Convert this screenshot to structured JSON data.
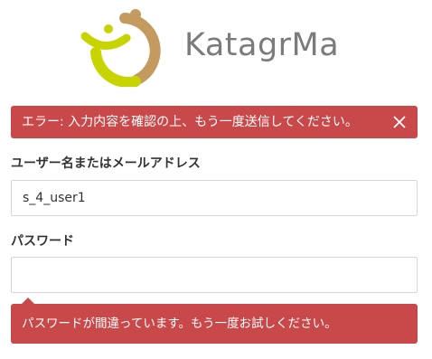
{
  "brand": {
    "name": "KatagrMa",
    "colors": {
      "lime": "#c8d400",
      "gold": "#c49a5e",
      "text_gray": "#7b7b7b"
    }
  },
  "alert": {
    "message": "エラー: 入力内容を確認の上、もう一度送信してください。",
    "close_icon": "close-icon",
    "color": "#c9484a"
  },
  "form": {
    "username": {
      "label": "ユーザー名またはメールアドレス",
      "value": "s_4_user1"
    },
    "password": {
      "label": "パスワード",
      "value": "",
      "error": "パスワードが間違っています。もう一度お試しください。"
    }
  }
}
